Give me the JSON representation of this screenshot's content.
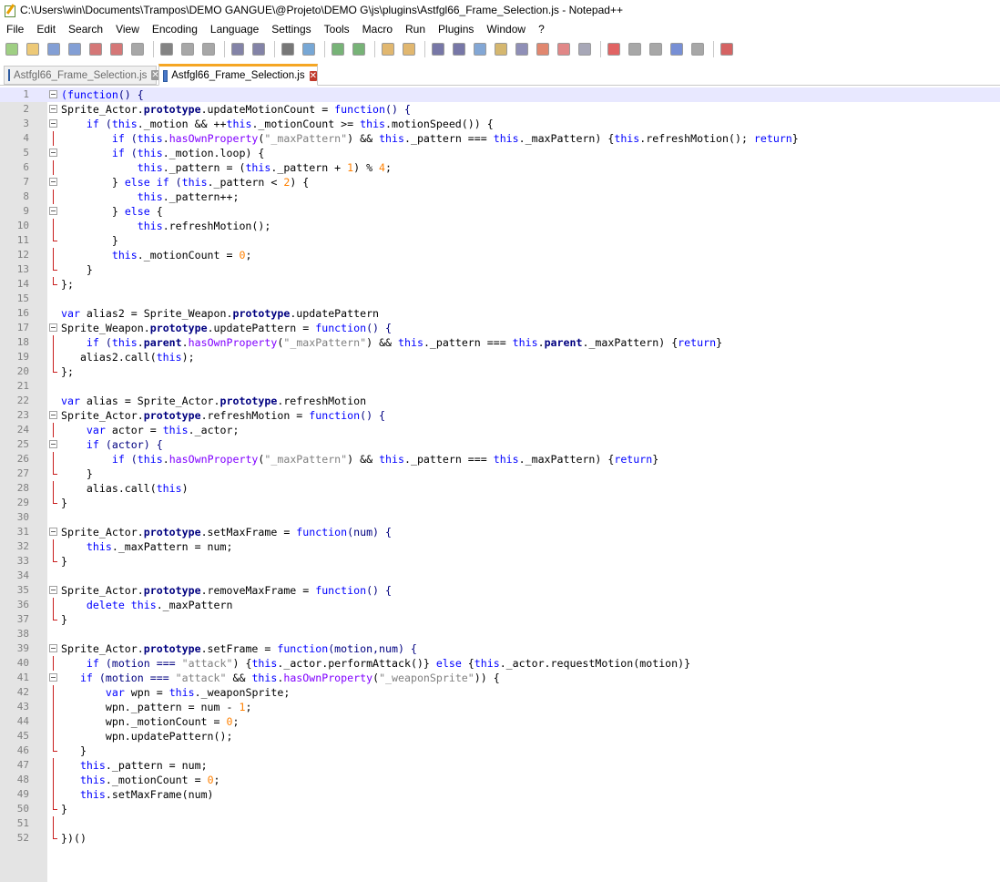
{
  "window": {
    "title": "C:\\Users\\win\\Documents\\Trampos\\DEMO GANGUE\\@Projeto\\DEMO G\\js\\plugins\\Astfgl66_Frame_Selection.js - Notepad++"
  },
  "menu": [
    "File",
    "Edit",
    "Search",
    "View",
    "Encoding",
    "Language",
    "Settings",
    "Tools",
    "Macro",
    "Run",
    "Plugins",
    "Window",
    "?"
  ],
  "toolbar": {
    "icons": [
      "new-file-icon",
      "open-file-icon",
      "save-icon",
      "save-all-icon",
      "close-icon",
      "close-all-icon",
      "print-icon",
      "cut-icon",
      "copy-icon",
      "paste-icon",
      "undo-icon",
      "redo-icon",
      "find-icon",
      "replace-icon",
      "zoom-in-icon",
      "zoom-out-icon",
      "sync-vertical-icon",
      "sync-horizontal-icon",
      "word-wrap-icon",
      "show-all-characters-icon",
      "indent-guide-icon",
      "user-defined-language-icon",
      "document-map-icon",
      "function-list-icon",
      "folder-as-workspace-icon",
      "monitoring-icon",
      "record-macro-icon",
      "stop-macro-icon",
      "play-macro-icon",
      "run-macro-multiple-icon",
      "save-macro-icon",
      "spellcheck-icon"
    ]
  },
  "tabs": [
    {
      "label": "Astfgl66_Frame_Selection.js",
      "active": false
    },
    {
      "label": "Astfgl66_Frame_Selection.js",
      "active": true
    }
  ],
  "editor": {
    "lines": [
      [
        [
          "kw",
          "(function"
        ],
        [
          "op",
          "() {"
        ]
      ],
      [
        [
          "pl",
          "Sprite_Actor."
        ],
        [
          "prop",
          "prototype"
        ],
        [
          "pl",
          ".updateMotionCount = "
        ],
        [
          "kw",
          "function"
        ],
        [
          "op",
          "() {"
        ]
      ],
      [
        [
          "pl",
          "    "
        ],
        [
          "kw",
          "if"
        ],
        [
          "op",
          " ("
        ],
        [
          "kw",
          "this"
        ],
        [
          "pl",
          "._motion && ++"
        ],
        [
          "kw",
          "this"
        ],
        [
          "pl",
          "._motionCount >= "
        ],
        [
          "kw",
          "this"
        ],
        [
          "pl",
          ".motionSpeed()) {"
        ]
      ],
      [
        [
          "pl",
          "        "
        ],
        [
          "kw",
          "if"
        ],
        [
          "op",
          " ("
        ],
        [
          "kw",
          "this"
        ],
        [
          "pl",
          "."
        ],
        [
          "fn",
          "hasOwnProperty"
        ],
        [
          "pl",
          "("
        ],
        [
          "str",
          "\"_maxPattern\""
        ],
        [
          "pl",
          ") && "
        ],
        [
          "kw",
          "this"
        ],
        [
          "pl",
          "._pattern === "
        ],
        [
          "kw",
          "this"
        ],
        [
          "pl",
          "._maxPattern) {"
        ],
        [
          "kw",
          "this"
        ],
        [
          "pl",
          ".refreshMotion(); "
        ],
        [
          "kw",
          "return"
        ],
        [
          "pl",
          "}"
        ]
      ],
      [
        [
          "pl",
          "        "
        ],
        [
          "kw",
          "if"
        ],
        [
          "op",
          " ("
        ],
        [
          "kw",
          "this"
        ],
        [
          "pl",
          "._motion.loop) {"
        ]
      ],
      [
        [
          "pl",
          "            "
        ],
        [
          "kw",
          "this"
        ],
        [
          "pl",
          "._pattern = ("
        ],
        [
          "kw",
          "this"
        ],
        [
          "pl",
          "._pattern + "
        ],
        [
          "num",
          "1"
        ],
        [
          "pl",
          ") % "
        ],
        [
          "num",
          "4"
        ],
        [
          "pl",
          ";"
        ]
      ],
      [
        [
          "pl",
          "        } "
        ],
        [
          "kw",
          "else if"
        ],
        [
          "op",
          " ("
        ],
        [
          "kw",
          "this"
        ],
        [
          "pl",
          "._pattern < "
        ],
        [
          "num",
          "2"
        ],
        [
          "pl",
          ") {"
        ]
      ],
      [
        [
          "pl",
          "            "
        ],
        [
          "kw",
          "this"
        ],
        [
          "pl",
          "._pattern++;"
        ]
      ],
      [
        [
          "pl",
          "        } "
        ],
        [
          "kw",
          "else"
        ],
        [
          "pl",
          " {"
        ]
      ],
      [
        [
          "pl",
          "            "
        ],
        [
          "kw",
          "this"
        ],
        [
          "pl",
          ".refreshMotion();"
        ]
      ],
      [
        [
          "pl",
          "        }"
        ]
      ],
      [
        [
          "pl",
          "        "
        ],
        [
          "kw",
          "this"
        ],
        [
          "pl",
          "._motionCount = "
        ],
        [
          "num",
          "0"
        ],
        [
          "pl",
          ";"
        ]
      ],
      [
        [
          "pl",
          "    }"
        ]
      ],
      [
        [
          "pl",
          "};"
        ]
      ],
      [
        [
          "pl",
          ""
        ]
      ],
      [
        [
          "kw",
          "var"
        ],
        [
          "pl",
          " alias2 = Sprite_Weapon."
        ],
        [
          "prop",
          "prototype"
        ],
        [
          "pl",
          ".updatePattern"
        ]
      ],
      [
        [
          "pl",
          "Sprite_Weapon."
        ],
        [
          "prop",
          "prototype"
        ],
        [
          "pl",
          ".updatePattern = "
        ],
        [
          "kw",
          "function"
        ],
        [
          "op",
          "() {"
        ]
      ],
      [
        [
          "pl",
          "    "
        ],
        [
          "kw",
          "if"
        ],
        [
          "op",
          " ("
        ],
        [
          "kw",
          "this"
        ],
        [
          "pl",
          "."
        ],
        [
          "prop",
          "parent"
        ],
        [
          "pl",
          "."
        ],
        [
          "fn",
          "hasOwnProperty"
        ],
        [
          "pl",
          "("
        ],
        [
          "str",
          "\"_maxPattern\""
        ],
        [
          "pl",
          ") && "
        ],
        [
          "kw",
          "this"
        ],
        [
          "pl",
          "._pattern === "
        ],
        [
          "kw",
          "this"
        ],
        [
          "pl",
          "."
        ],
        [
          "prop",
          "parent"
        ],
        [
          "pl",
          "._maxPattern) {"
        ],
        [
          "kw",
          "return"
        ],
        [
          "pl",
          "}"
        ]
      ],
      [
        [
          "pl",
          "   alias2.call("
        ],
        [
          "kw",
          "this"
        ],
        [
          "pl",
          ");"
        ]
      ],
      [
        [
          "pl",
          "};"
        ]
      ],
      [
        [
          "pl",
          ""
        ]
      ],
      [
        [
          "kw",
          "var"
        ],
        [
          "pl",
          " alias = Sprite_Actor."
        ],
        [
          "prop",
          "prototype"
        ],
        [
          "pl",
          ".refreshMotion"
        ]
      ],
      [
        [
          "pl",
          "Sprite_Actor."
        ],
        [
          "prop",
          "prototype"
        ],
        [
          "pl",
          ".refreshMotion = "
        ],
        [
          "kw",
          "function"
        ],
        [
          "op",
          "() {"
        ]
      ],
      [
        [
          "pl",
          "    "
        ],
        [
          "kw",
          "var"
        ],
        [
          "pl",
          " actor = "
        ],
        [
          "kw",
          "this"
        ],
        [
          "pl",
          "._actor;"
        ]
      ],
      [
        [
          "pl",
          "    "
        ],
        [
          "kw",
          "if"
        ],
        [
          "op",
          " (actor) {"
        ]
      ],
      [
        [
          "pl",
          "        "
        ],
        [
          "kw",
          "if"
        ],
        [
          "op",
          " ("
        ],
        [
          "kw",
          "this"
        ],
        [
          "pl",
          "."
        ],
        [
          "fn",
          "hasOwnProperty"
        ],
        [
          "pl",
          "("
        ],
        [
          "str",
          "\"_maxPattern\""
        ],
        [
          "pl",
          ") && "
        ],
        [
          "kw",
          "this"
        ],
        [
          "pl",
          "._pattern === "
        ],
        [
          "kw",
          "this"
        ],
        [
          "pl",
          "._maxPattern) {"
        ],
        [
          "kw",
          "return"
        ],
        [
          "pl",
          "}"
        ]
      ],
      [
        [
          "pl",
          "    }"
        ]
      ],
      [
        [
          "pl",
          "    alias.call("
        ],
        [
          "kw",
          "this"
        ],
        [
          "pl",
          ")"
        ]
      ],
      [
        [
          "pl",
          "}"
        ]
      ],
      [
        [
          "pl",
          ""
        ]
      ],
      [
        [
          "pl",
          "Sprite_Actor."
        ],
        [
          "prop",
          "prototype"
        ],
        [
          "pl",
          ".setMaxFrame = "
        ],
        [
          "kw",
          "function"
        ],
        [
          "op",
          "(num) {"
        ]
      ],
      [
        [
          "pl",
          "    "
        ],
        [
          "kw",
          "this"
        ],
        [
          "pl",
          "._maxPattern = num;"
        ]
      ],
      [
        [
          "pl",
          "}"
        ]
      ],
      [
        [
          "pl",
          ""
        ]
      ],
      [
        [
          "pl",
          "Sprite_Actor."
        ],
        [
          "prop",
          "prototype"
        ],
        [
          "pl",
          ".removeMaxFrame = "
        ],
        [
          "kw",
          "function"
        ],
        [
          "op",
          "() {"
        ]
      ],
      [
        [
          "pl",
          "    "
        ],
        [
          "kw",
          "delete this"
        ],
        [
          "pl",
          "._maxPattern"
        ]
      ],
      [
        [
          "pl",
          "}"
        ]
      ],
      [
        [
          "pl",
          ""
        ]
      ],
      [
        [
          "pl",
          "Sprite_Actor."
        ],
        [
          "prop",
          "prototype"
        ],
        [
          "pl",
          ".setFrame = "
        ],
        [
          "kw",
          "function"
        ],
        [
          "op",
          "(motion,num) {"
        ]
      ],
      [
        [
          "pl",
          "    "
        ],
        [
          "kw",
          "if"
        ],
        [
          "op",
          " (motion === "
        ],
        [
          "str",
          "\"attack\""
        ],
        [
          "pl",
          ") {"
        ],
        [
          "kw",
          "this"
        ],
        [
          "pl",
          "._actor.performAttack()} "
        ],
        [
          "kw",
          "else"
        ],
        [
          "pl",
          " {"
        ],
        [
          "kw",
          "this"
        ],
        [
          "pl",
          "._actor.requestMotion(motion)}"
        ]
      ],
      [
        [
          "pl",
          "   "
        ],
        [
          "kw",
          "if"
        ],
        [
          "op",
          " (motion === "
        ],
        [
          "str",
          "\"attack\""
        ],
        [
          "pl",
          " && "
        ],
        [
          "kw",
          "this"
        ],
        [
          "pl",
          "."
        ],
        [
          "fn",
          "hasOwnProperty"
        ],
        [
          "pl",
          "("
        ],
        [
          "str",
          "\"_weaponSprite\""
        ],
        [
          "pl",
          ")) {"
        ]
      ],
      [
        [
          "pl",
          "       "
        ],
        [
          "kw",
          "var"
        ],
        [
          "pl",
          " wpn = "
        ],
        [
          "kw",
          "this"
        ],
        [
          "pl",
          "._weaponSprite;"
        ]
      ],
      [
        [
          "pl",
          "       wpn._pattern = num - "
        ],
        [
          "num",
          "1"
        ],
        [
          "pl",
          ";"
        ]
      ],
      [
        [
          "pl",
          "       wpn._motionCount = "
        ],
        [
          "num",
          "0"
        ],
        [
          "pl",
          ";"
        ]
      ],
      [
        [
          "pl",
          "       wpn.updatePattern();"
        ]
      ],
      [
        [
          "pl",
          "   }"
        ]
      ],
      [
        [
          "pl",
          "   "
        ],
        [
          "kw",
          "this"
        ],
        [
          "pl",
          "._pattern = num;"
        ]
      ],
      [
        [
          "pl",
          "   "
        ],
        [
          "kw",
          "this"
        ],
        [
          "pl",
          "._motionCount = "
        ],
        [
          "num",
          "0"
        ],
        [
          "pl",
          ";"
        ]
      ],
      [
        [
          "pl",
          "   "
        ],
        [
          "kw",
          "this"
        ],
        [
          "pl",
          ".setMaxFrame(num)"
        ]
      ],
      [
        [
          "pl",
          "}"
        ]
      ],
      [
        [
          "pl",
          ""
        ]
      ],
      [
        [
          "pl",
          "})()"
        ]
      ]
    ],
    "folds": [
      "box",
      "box",
      "box",
      "vline",
      "box",
      "vline",
      "box",
      "vline",
      "box",
      "vline",
      "end",
      "vline",
      "end",
      "end",
      "none",
      "none",
      "box",
      "vline",
      "vline",
      "end",
      "none",
      "none",
      "box",
      "vline",
      "box",
      "vline",
      "end",
      "vline",
      "end",
      "none",
      "box",
      "vline",
      "end",
      "none",
      "box",
      "vline",
      "end",
      "none",
      "box",
      "vline",
      "box",
      "vline",
      "vline",
      "vline",
      "vline",
      "end",
      "vline",
      "vline",
      "vline",
      "end",
      "vline",
      "end"
    ]
  }
}
